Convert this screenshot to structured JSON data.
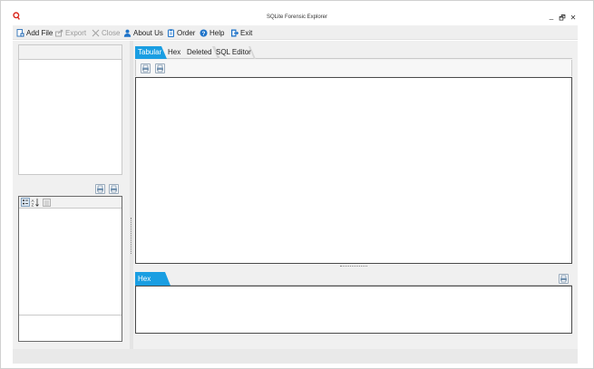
{
  "window": {
    "title": "SQLite Forensic Explorer",
    "controls": {
      "minimize": "_",
      "maximize": "🗗",
      "close": "✕"
    },
    "accent": "#1a9ee2"
  },
  "toolbar": {
    "add_file": "Add File",
    "export": "Export",
    "close": "Close",
    "about_us": "About Us",
    "order": "Order",
    "help": "Help",
    "exit": "Exit"
  },
  "main_tabs": [
    {
      "label": "Tabular",
      "active": true
    },
    {
      "label": "Hex",
      "active": false
    },
    {
      "label": "Deleted",
      "active": false
    },
    {
      "label": "SQL Editor",
      "active": false
    }
  ],
  "hex_panel": {
    "title": "Hex"
  },
  "icons": {
    "app": "sqlite-logo-icon",
    "add_file": "add-file-icon",
    "export": "export-icon",
    "close": "close-x-icon",
    "about": "user-icon",
    "order": "clipboard-icon",
    "help": "help-icon",
    "exit": "exit-icon",
    "print": "print-icon"
  }
}
